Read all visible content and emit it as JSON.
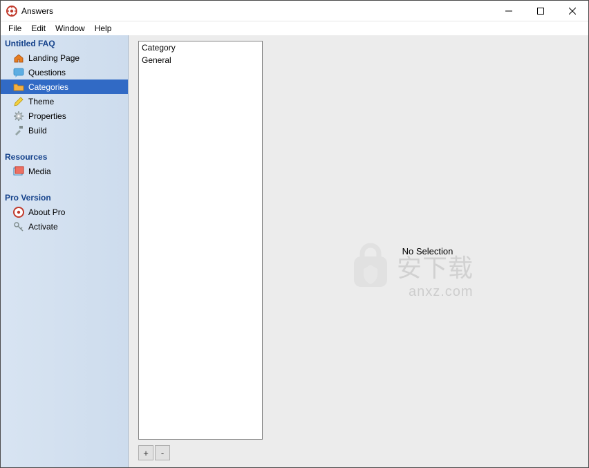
{
  "app": {
    "title": "Answers"
  },
  "menu": {
    "file": "File",
    "edit": "Edit",
    "window": "Window",
    "help": "Help"
  },
  "sidebar": {
    "section_faq": "Untitled FAQ",
    "items": [
      {
        "label": "Landing Page"
      },
      {
        "label": "Questions"
      },
      {
        "label": "Categories"
      },
      {
        "label": "Theme"
      },
      {
        "label": "Properties"
      },
      {
        "label": "Build"
      }
    ],
    "section_resources": "Resources",
    "resources": [
      {
        "label": "Media"
      }
    ],
    "section_pro": "Pro Version",
    "pro": [
      {
        "label": "About Pro"
      },
      {
        "label": "Activate"
      }
    ]
  },
  "list": {
    "header": "Category",
    "rows": [
      "General"
    ]
  },
  "buttons": {
    "add": "+",
    "remove": "-"
  },
  "detail": {
    "no_selection": "No Selection"
  },
  "watermark": {
    "main": "安下载",
    "sub": "anxz.com"
  }
}
